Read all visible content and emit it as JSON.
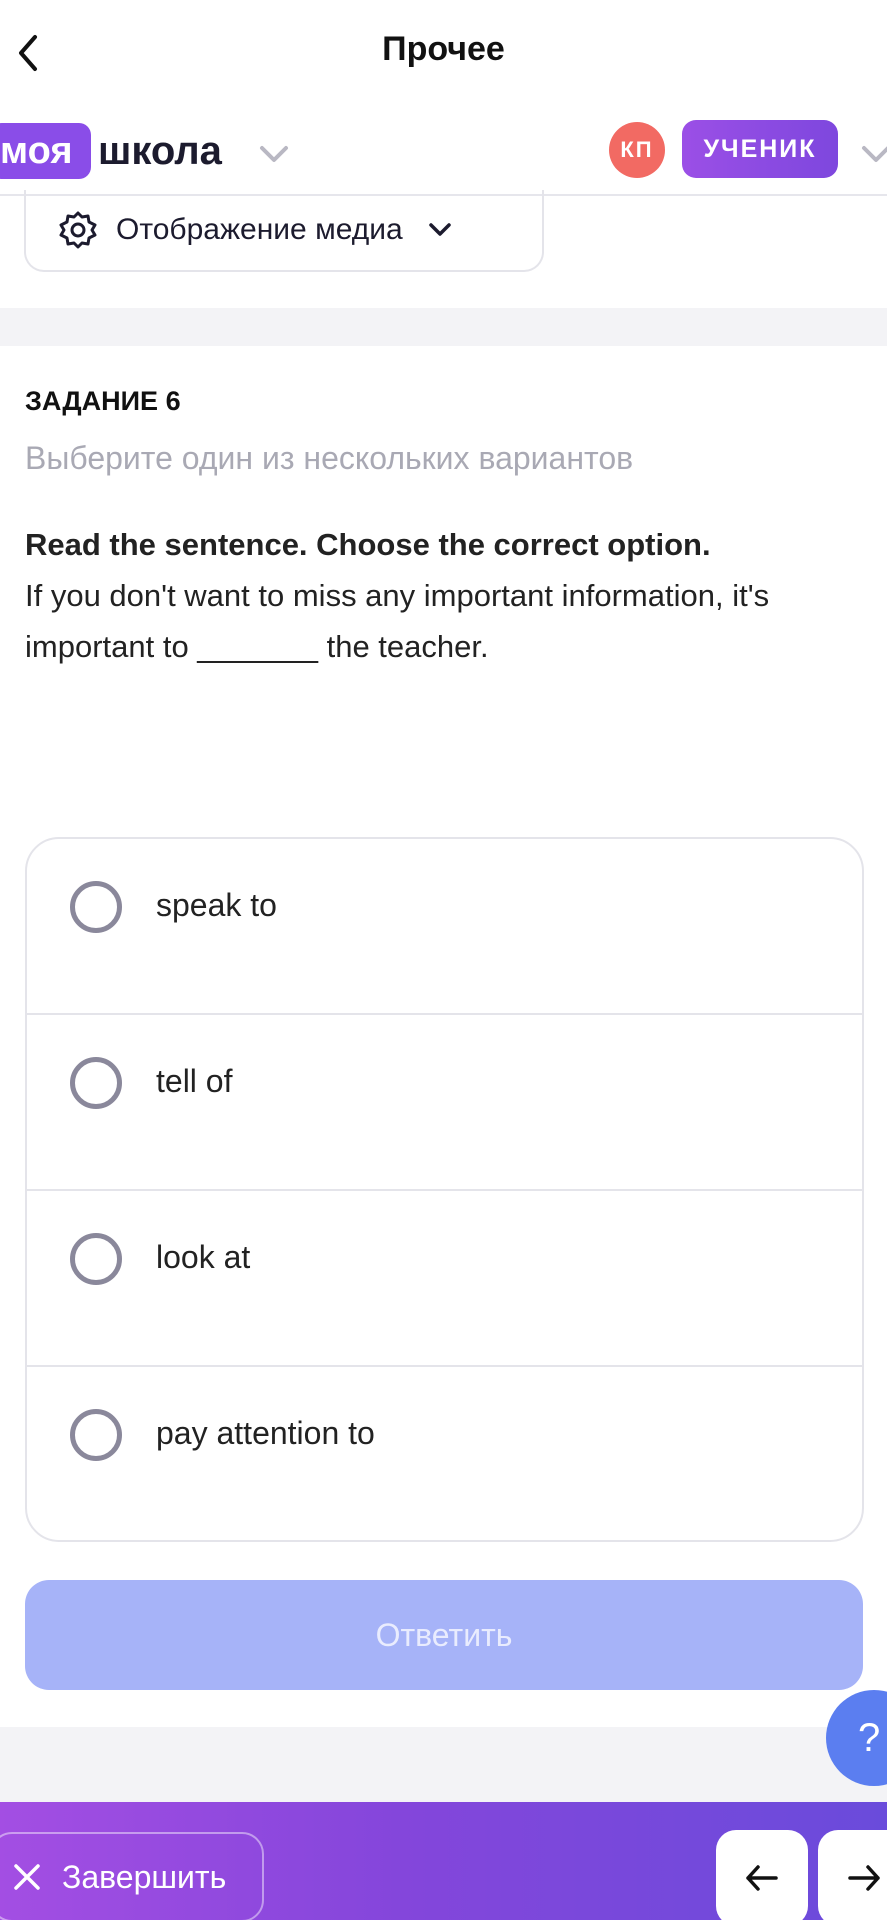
{
  "nav": {
    "title": "Прочее"
  },
  "header": {
    "logo_pill": "моя",
    "logo_text": "школа",
    "avatar_initials": "КП",
    "role_label": "УЧЕНИК"
  },
  "media": {
    "label": "Отображение медиа"
  },
  "task": {
    "number_label": "ЗАДАНИЕ 6",
    "hint": "Выберите один из нескольких вариантов",
    "instruction": "Read the sentence. Choose the correct option.",
    "sentence": "If you don't want to miss any important information, it's important to _______ the teacher."
  },
  "options": [
    {
      "label": "speak to"
    },
    {
      "label": "tell of"
    },
    {
      "label": "look at"
    },
    {
      "label": "pay attention to"
    }
  ],
  "submit": {
    "label": "Ответить"
  },
  "help": {
    "label": "?"
  },
  "bottom": {
    "finish_label": "Завершить"
  },
  "colors": {
    "accent": "#8a4de8",
    "avatar": "#f26a63",
    "submit_disabled": "#a6b3f8",
    "help": "#5b7ef0"
  }
}
